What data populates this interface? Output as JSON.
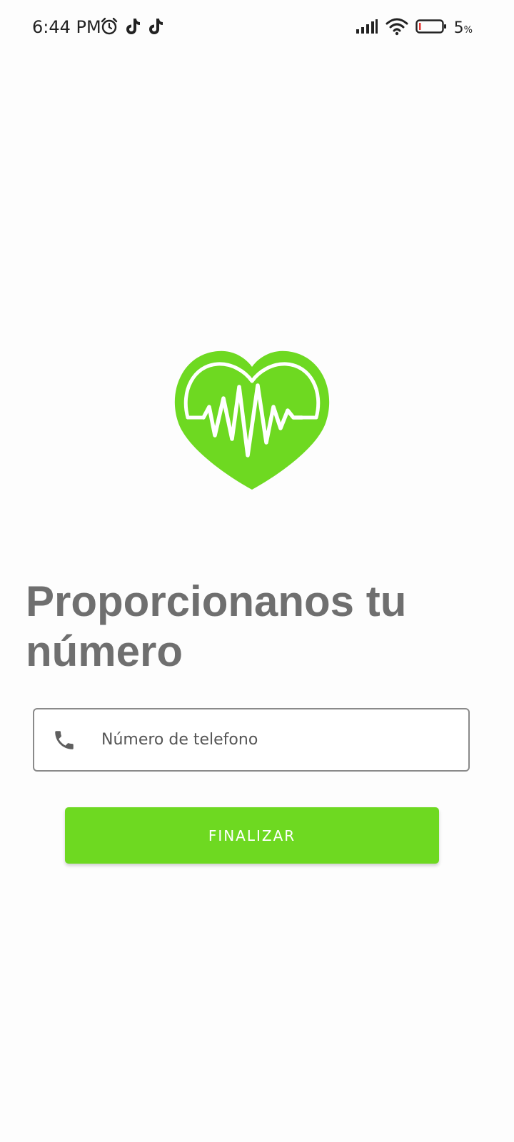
{
  "status_bar": {
    "time": "6:44 PM",
    "battery_level": "5",
    "battery_unit": "%",
    "left_icons": [
      "alarm-icon",
      "tiktok-icon",
      "tiktok-icon"
    ],
    "right_icons": [
      "signal-icon",
      "wifi-icon",
      "battery-icon"
    ]
  },
  "logo": {
    "icon": "heart-pulse-icon",
    "color": "#6ed921"
  },
  "main": {
    "title": "Proporcionanos tu número",
    "phone_field": {
      "icon": "phone-icon",
      "placeholder": "Número de telefono",
      "value": ""
    },
    "finish_button_label": "FINALIZAR"
  },
  "colors": {
    "accent": "#6ed921",
    "title_text": "#6f6f6f",
    "field_border": "#8a8a8a"
  }
}
